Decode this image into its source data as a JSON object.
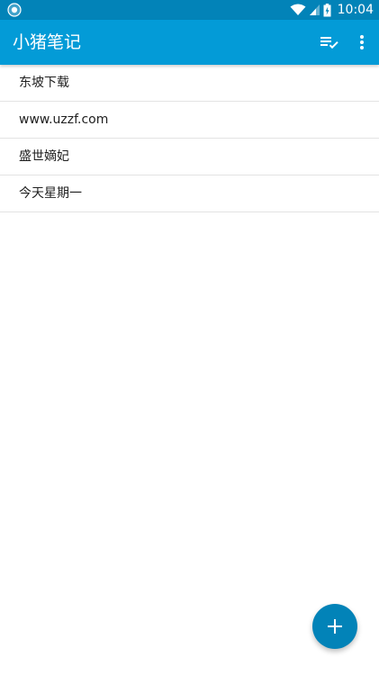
{
  "status_bar": {
    "time": "10:04",
    "icons": [
      "app-notification-icon",
      "wifi-icon",
      "cell-signal-icon",
      "battery-charging-icon"
    ]
  },
  "app_bar": {
    "title": "小猪笔记",
    "actions": [
      {
        "name": "sort-icon"
      },
      {
        "name": "more-vert-icon"
      }
    ]
  },
  "notes": [
    {
      "title": "东坡下载"
    },
    {
      "title": "www.uzzf.com"
    },
    {
      "title": "盛世嫡妃"
    },
    {
      "title": "今天星期一"
    }
  ],
  "fab": {
    "icon": "add-icon"
  },
  "colors": {
    "status_bar": "#0283b8",
    "app_bar": "#039bd7",
    "fab": "#0283b8",
    "divider": "#e3e3e3"
  }
}
